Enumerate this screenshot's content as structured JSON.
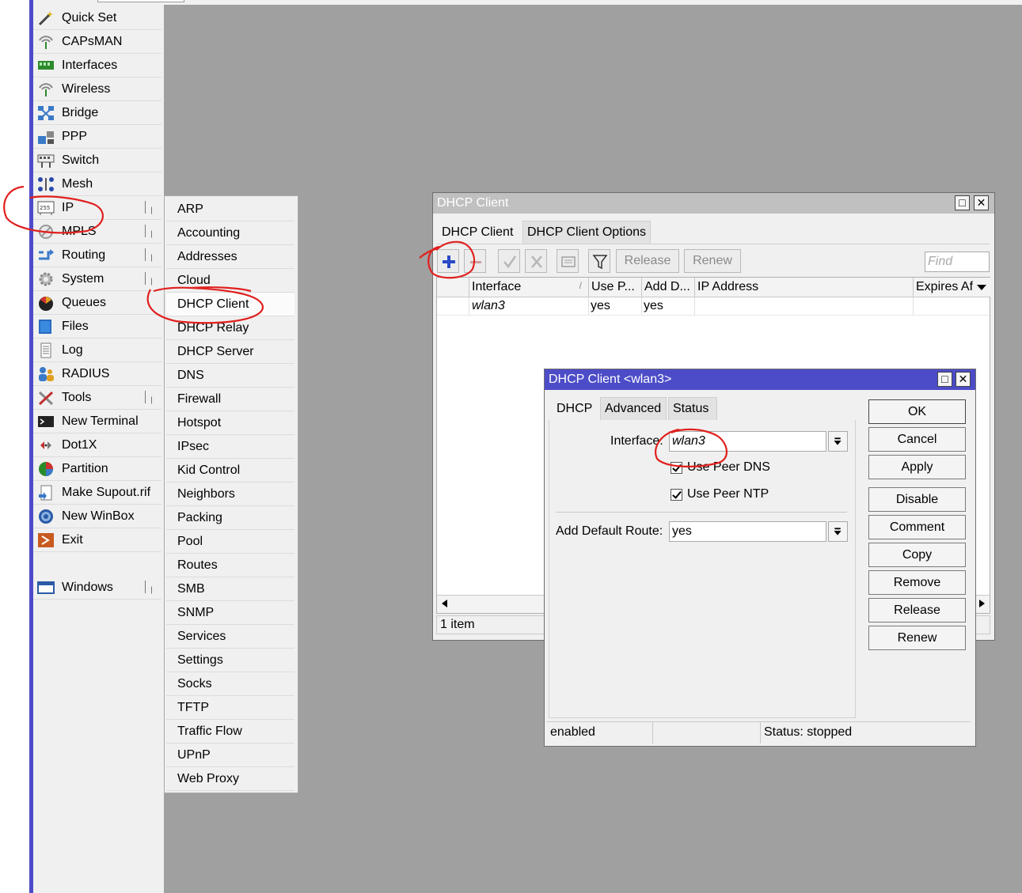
{
  "left_menu": {
    "items": [
      {
        "label": "Quick Set",
        "icon": "wand-icon",
        "submenu": false
      },
      {
        "label": "CAPsMAN",
        "icon": "antenna-icon",
        "submenu": false
      },
      {
        "label": "Interfaces",
        "icon": "interfaces-icon",
        "submenu": false
      },
      {
        "label": "Wireless",
        "icon": "wireless-icon",
        "submenu": false
      },
      {
        "label": "Bridge",
        "icon": "bridge-icon",
        "submenu": false
      },
      {
        "label": "PPP",
        "icon": "ppp-icon",
        "submenu": false
      },
      {
        "label": "Switch",
        "icon": "switch-icon",
        "submenu": false
      },
      {
        "label": "Mesh",
        "icon": "mesh-icon",
        "submenu": false
      },
      {
        "label": "IP",
        "icon": "ip-icon",
        "submenu": true
      },
      {
        "label": "MPLS",
        "icon": "mpls-icon",
        "submenu": true
      },
      {
        "label": "Routing",
        "icon": "routing-icon",
        "submenu": true
      },
      {
        "label": "System",
        "icon": "gear-icon",
        "submenu": true
      },
      {
        "label": "Queues",
        "icon": "queues-icon",
        "submenu": false
      },
      {
        "label": "Files",
        "icon": "folder-icon",
        "submenu": false
      },
      {
        "label": "Log",
        "icon": "log-icon",
        "submenu": false
      },
      {
        "label": "RADIUS",
        "icon": "radius-icon",
        "submenu": false
      },
      {
        "label": "Tools",
        "icon": "tools-icon",
        "submenu": true
      },
      {
        "label": "New Terminal",
        "icon": "terminal-icon",
        "submenu": false
      },
      {
        "label": "Dot1X",
        "icon": "dot1x-icon",
        "submenu": false
      },
      {
        "label": "Partition",
        "icon": "partition-icon",
        "submenu": false
      },
      {
        "label": "Make Supout.rif",
        "icon": "supout-icon",
        "submenu": false
      },
      {
        "label": "New WinBox",
        "icon": "winbox-icon",
        "submenu": false
      },
      {
        "label": "Exit",
        "icon": "exit-icon",
        "submenu": false
      }
    ],
    "windows_label": "Windows"
  },
  "ip_submenu": {
    "items": [
      "ARP",
      "Accounting",
      "Addresses",
      "Cloud",
      "DHCP Client",
      "DHCP Relay",
      "DHCP Server",
      "DNS",
      "Firewall",
      "Hotspot",
      "IPsec",
      "Kid Control",
      "Neighbors",
      "Packing",
      "Pool",
      "Routes",
      "SMB",
      "SNMP",
      "Services",
      "Settings",
      "Socks",
      "TFTP",
      "Traffic Flow",
      "UPnP",
      "Web Proxy"
    ],
    "selected": "DHCP Client"
  },
  "dhcp_client_window": {
    "title": "DHCP Client",
    "tabs": [
      "DHCP Client",
      "DHCP Client Options"
    ],
    "toolbar": {
      "release_label": "Release",
      "renew_label": "Renew",
      "find_placeholder": "Find"
    },
    "columns": [
      "Interface",
      "Use P...",
      "Add D...",
      "IP Address",
      "Expires Af"
    ],
    "rows": [
      {
        "interface": "wlan3",
        "use_peer": "yes",
        "add_default": "yes",
        "ip": "",
        "expires": ""
      }
    ],
    "status": "1 item"
  },
  "dhcp_detail_window": {
    "title": "DHCP Client <wlan3>",
    "tabs": [
      "DHCP",
      "Advanced",
      "Status"
    ],
    "interface_label": "Interface:",
    "interface_value": "wlan3",
    "use_peer_dns_label": "Use Peer DNS",
    "use_peer_ntp_label": "Use Peer NTP",
    "add_default_route_label": "Add Default Route:",
    "add_default_route_value": "yes",
    "buttons": [
      "OK",
      "Cancel",
      "Apply",
      "Disable",
      "Comment",
      "Copy",
      "Remove",
      "Release",
      "Renew"
    ],
    "status_left": "enabled",
    "status_mid": "",
    "status_right": "Status: stopped"
  },
  "colors": {
    "title_active": "#4c4cc8",
    "title_inactive": "#c0c0c0",
    "annotation": "#e0201e",
    "desktop": "#a0a0a0"
  }
}
